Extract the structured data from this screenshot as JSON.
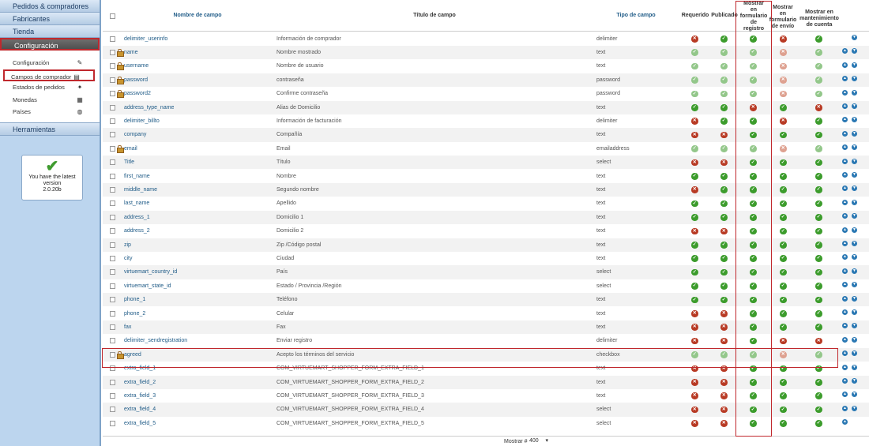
{
  "sidebar": {
    "menus_top": [
      {
        "label": "Pedidos & compradores",
        "active": false
      },
      {
        "label": "Fabricantes",
        "active": false
      },
      {
        "label": "Tienda",
        "active": false
      },
      {
        "label": "Configuración",
        "active": true
      }
    ],
    "submenu": [
      {
        "label": "Configuración",
        "icon": "config-icon",
        "glyph": "✎",
        "active": false
      },
      {
        "label": "Campos de comprador",
        "icon": "shopper-fields-icon",
        "glyph": "▤",
        "active": true
      },
      {
        "label": "Estados de pedidos",
        "icon": "order-status-icon",
        "glyph": "✦",
        "active": false
      },
      {
        "label": "Monedas",
        "icon": "currency-icon",
        "glyph": "▦",
        "active": false
      },
      {
        "label": "Países",
        "icon": "globe-icon",
        "glyph": "◍",
        "active": false
      }
    ],
    "menu_tools": "Herramientas",
    "version_box": {
      "icon": "checkmark-icon",
      "glyph": "✔",
      "line1": "You have the latest",
      "line2": "version",
      "line3": "2.0.20b"
    }
  },
  "table": {
    "headers": {
      "name": "Nombre de campo",
      "title": "Título de campo",
      "type": "Tipo de campo",
      "required": "Requerido",
      "published": "Publicado",
      "registration": [
        "Mostrar",
        "en",
        "formulario",
        "de",
        "registro"
      ],
      "shipment": [
        "Mostrar",
        "en",
        "formulario",
        "de envío"
      ],
      "account": [
        "Mostrar en",
        "mantenimiento",
        "de cuenta"
      ]
    },
    "rows": [
      {
        "name": "delimiter_userinfo",
        "title": "Información de comprador",
        "type": "delimiter",
        "locked": false,
        "flags": [
          0,
          1,
          1,
          0,
          1
        ],
        "dim": false,
        "up": false,
        "down": true
      },
      {
        "name": "name",
        "title": "Nombre mostrado",
        "type": "text",
        "locked": true,
        "flags": [
          1,
          1,
          1,
          0,
          1
        ],
        "dim": true,
        "up": true,
        "down": true
      },
      {
        "name": "username",
        "title": "Nombre de usuario",
        "type": "text",
        "locked": true,
        "flags": [
          1,
          1,
          1,
          0,
          1
        ],
        "dim": true,
        "up": true,
        "down": true
      },
      {
        "name": "password",
        "title": "contraseña",
        "type": "password",
        "locked": true,
        "flags": [
          1,
          1,
          1,
          0,
          1
        ],
        "dim": true,
        "up": true,
        "down": true
      },
      {
        "name": "password2",
        "title": "Confirme contraseña",
        "type": "password",
        "locked": true,
        "flags": [
          1,
          1,
          1,
          0,
          1
        ],
        "dim": true,
        "up": true,
        "down": true
      },
      {
        "name": "address_type_name",
        "title": "Alias de Domicilio",
        "type": "text",
        "locked": false,
        "flags": [
          1,
          1,
          0,
          1,
          0
        ],
        "dim": false,
        "up": true,
        "down": true
      },
      {
        "name": "delimiter_billto",
        "title": "Información de facturación",
        "type": "delimiter",
        "locked": false,
        "flags": [
          0,
          1,
          1,
          0,
          1
        ],
        "dim": false,
        "up": true,
        "down": true
      },
      {
        "name": "company",
        "title": "Compañía",
        "type": "text",
        "locked": false,
        "flags": [
          0,
          0,
          1,
          1,
          1
        ],
        "dim": false,
        "up": true,
        "down": true
      },
      {
        "name": "email",
        "title": "Email",
        "type": "emailaddress",
        "locked": true,
        "flags": [
          1,
          1,
          1,
          0,
          1
        ],
        "dim": true,
        "up": true,
        "down": true
      },
      {
        "name": "Title",
        "title": "Título",
        "type": "select",
        "locked": false,
        "flags": [
          0,
          0,
          1,
          1,
          1
        ],
        "dim": false,
        "up": true,
        "down": true
      },
      {
        "name": "first_name",
        "title": "Nombre",
        "type": "text",
        "locked": false,
        "flags": [
          1,
          1,
          1,
          1,
          1
        ],
        "dim": false,
        "up": true,
        "down": true
      },
      {
        "name": "middle_name",
        "title": "Segundo nombre",
        "type": "text",
        "locked": false,
        "flags": [
          0,
          1,
          1,
          1,
          1
        ],
        "dim": false,
        "up": true,
        "down": true
      },
      {
        "name": "last_name",
        "title": "Apellido",
        "type": "text",
        "locked": false,
        "flags": [
          1,
          1,
          1,
          1,
          1
        ],
        "dim": false,
        "up": true,
        "down": true
      },
      {
        "name": "address_1",
        "title": "Domicilio 1",
        "type": "text",
        "locked": false,
        "flags": [
          1,
          1,
          1,
          1,
          1
        ],
        "dim": false,
        "up": true,
        "down": true
      },
      {
        "name": "address_2",
        "title": "Domicilio 2",
        "type": "text",
        "locked": false,
        "flags": [
          0,
          0,
          1,
          1,
          1
        ],
        "dim": false,
        "up": true,
        "down": true
      },
      {
        "name": "zip",
        "title": "Zip /Código postal",
        "type": "text",
        "locked": false,
        "flags": [
          1,
          1,
          1,
          1,
          1
        ],
        "dim": false,
        "up": true,
        "down": true
      },
      {
        "name": "city",
        "title": "Ciudad",
        "type": "text",
        "locked": false,
        "flags": [
          1,
          1,
          1,
          1,
          1
        ],
        "dim": false,
        "up": true,
        "down": true
      },
      {
        "name": "virtuemart_country_id",
        "title": "País",
        "type": "select",
        "locked": false,
        "flags": [
          1,
          1,
          1,
          1,
          1
        ],
        "dim": false,
        "up": true,
        "down": true
      },
      {
        "name": "virtuemart_state_id",
        "title": "Estado / Provincia /Región",
        "type": "select",
        "locked": false,
        "flags": [
          1,
          1,
          1,
          1,
          1
        ],
        "dim": false,
        "up": true,
        "down": true
      },
      {
        "name": "phone_1",
        "title": "Teléfono",
        "type": "text",
        "locked": false,
        "flags": [
          1,
          1,
          1,
          1,
          1
        ],
        "dim": false,
        "up": true,
        "down": true
      },
      {
        "name": "phone_2",
        "title": "Celular",
        "type": "text",
        "locked": false,
        "flags": [
          0,
          0,
          1,
          1,
          1
        ],
        "dim": false,
        "up": true,
        "down": true
      },
      {
        "name": "fax",
        "title": "Fax",
        "type": "text",
        "locked": false,
        "flags": [
          0,
          0,
          1,
          1,
          1
        ],
        "dim": false,
        "up": true,
        "down": true
      },
      {
        "name": "delimiter_sendregistration",
        "title": "Enviar registro",
        "type": "delimiter",
        "locked": false,
        "flags": [
          0,
          0,
          1,
          0,
          0
        ],
        "dim": false,
        "up": true,
        "down": true
      },
      {
        "name": "agreed",
        "title": "Acepto los términos del servicio",
        "type": "checkbox",
        "locked": true,
        "flags": [
          1,
          1,
          1,
          0,
          1
        ],
        "dim": true,
        "up": true,
        "down": true
      },
      {
        "name": "extra_field_1",
        "title": "COM_VIRTUEMART_SHOPPER_FORM_EXTRA_FIELD_1",
        "type": "text",
        "locked": false,
        "flags": [
          0,
          0,
          1,
          1,
          1
        ],
        "dim": false,
        "up": true,
        "down": true
      },
      {
        "name": "extra_field_2",
        "title": "COM_VIRTUEMART_SHOPPER_FORM_EXTRA_FIELD_2",
        "type": "text",
        "locked": false,
        "flags": [
          0,
          0,
          1,
          1,
          1
        ],
        "dim": false,
        "up": true,
        "down": true
      },
      {
        "name": "extra_field_3",
        "title": "COM_VIRTUEMART_SHOPPER_FORM_EXTRA_FIELD_3",
        "type": "text",
        "locked": false,
        "flags": [
          0,
          0,
          1,
          1,
          1
        ],
        "dim": false,
        "up": true,
        "down": true
      },
      {
        "name": "extra_field_4",
        "title": "COM_VIRTUEMART_SHOPPER_FORM_EXTRA_FIELD_4",
        "type": "select",
        "locked": false,
        "flags": [
          0,
          0,
          1,
          1,
          1
        ],
        "dim": false,
        "up": true,
        "down": true
      },
      {
        "name": "extra_field_5",
        "title": "COM_VIRTUEMART_SHOPPER_FORM_EXTRA_FIELD_5",
        "type": "select",
        "locked": false,
        "flags": [
          0,
          0,
          1,
          1,
          1
        ],
        "dim": false,
        "up": true,
        "down": false
      }
    ],
    "icons": {
      "on_glyph": "✓",
      "off_glyph": "✕",
      "up_glyph": "▲",
      "down_glyph": "▼"
    }
  },
  "footer": {
    "label": "Mostrar #",
    "limit": "400"
  },
  "colors": {
    "on": "#3c9c2c",
    "off": "#b83a24",
    "highlight": "#c0282d",
    "link": "#1f5b87"
  }
}
